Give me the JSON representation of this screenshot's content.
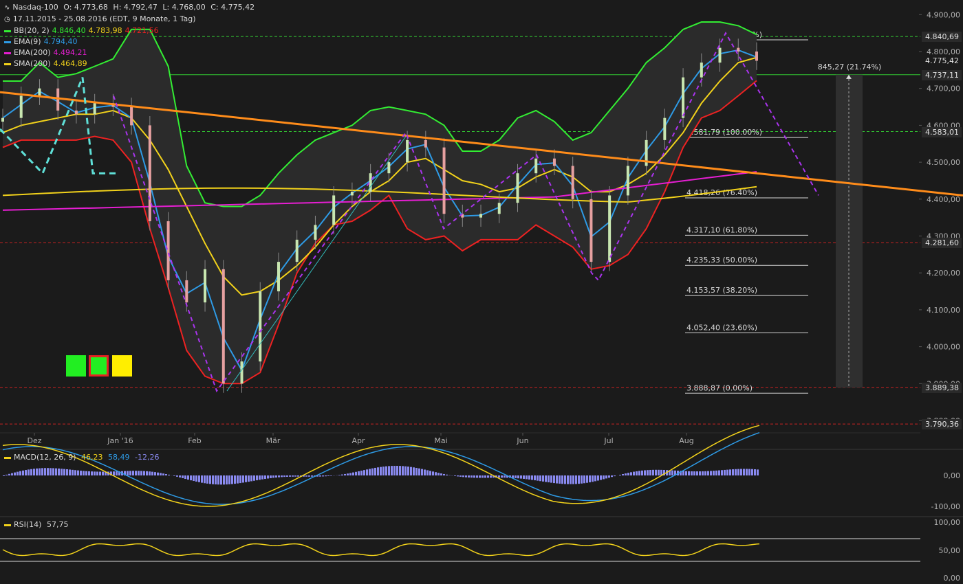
{
  "header": {
    "symbol": "Nasdaq-100",
    "open": "O: 4.773,68",
    "high": "H: 4.792,47",
    "low": "L: 4.768,00",
    "close": "C: 4.775,42",
    "range": "17.11.2015 - 25.08.2016 (EDT, 9 Monate, 1 Tag)",
    "indicators": [
      {
        "label": "BB(20, 2)",
        "color": "#33ee33",
        "values": [
          {
            "text": "4.846,40",
            "color": "#33ee33"
          },
          {
            "text": "4.783,98",
            "color": "#f2d21b"
          },
          {
            "text": "4.721,56",
            "color": "#ee2222"
          }
        ]
      },
      {
        "label": "EMA(9)",
        "color": "#2e9be6",
        "values": [
          {
            "text": "4.794,40",
            "color": "#2e9be6"
          }
        ]
      },
      {
        "label": "EMA(200)",
        "color": "#e61ed2",
        "values": [
          {
            "text": "4.494,21",
            "color": "#e61ed2"
          }
        ]
      },
      {
        "label": "SMA(200)",
        "color": "#f2d21b",
        "values": [
          {
            "text": "4.464,89",
            "color": "#f2d21b"
          }
        ]
      }
    ]
  },
  "price_axis": [
    "4.900,00",
    "4.800,00",
    "4.700,00",
    "4.600,00",
    "4.500,00",
    "4.400,00",
    "4.300,00",
    "4.200,00",
    "4.100,00",
    "4.000,00",
    "3.900,00",
    "3.800,00"
  ],
  "price_labels": [
    {
      "text": "4.840,69",
      "bg": "#2a2a2a",
      "fg": "#e0e0e0"
    },
    {
      "text": "4.775,42",
      "bg": "#1b1b1b",
      "fg": "#e0e0e0"
    },
    {
      "text": "4.737,11",
      "bg": "#2a2a2a",
      "fg": "#e0e0e0"
    },
    {
      "text": "4.583,01",
      "bg": "#2a2a2a",
      "fg": "#e0e0e0"
    },
    {
      "text": "4.281,60",
      "bg": "#2a2a2a",
      "fg": "#e0e0e0"
    },
    {
      "text": "3.889,38",
      "bg": "#2a2a2a",
      "fg": "#e0e0e0"
    },
    {
      "text": "3.790,36",
      "bg": "#2a2a2a",
      "fg": "#e0e0e0"
    }
  ],
  "months": [
    "Dez",
    "Jan '16",
    "Feb",
    "Mär",
    "Apr",
    "Mai",
    "Jun",
    "Jul",
    "Aug"
  ],
  "fib_levels": [
    {
      "price": 4846.49,
      "label": "4.846,49 (138.20%)"
    },
    {
      "price": 4581.79,
      "label": "4.581,79 (100.00%)"
    },
    {
      "price": 4418.26,
      "label": "4.418,26 (76.40%)"
    },
    {
      "price": 4317.1,
      "label": "4.317,10 (61.80%)"
    },
    {
      "price": 4235.33,
      "label": "4.235,33 (50.00%)"
    },
    {
      "price": 4153.57,
      "label": "4.153,57 (38.20%)"
    },
    {
      "price": 4052.4,
      "label": "4.052,40 (23.60%)"
    },
    {
      "price": 3888.87,
      "label": "3.888,87 (0.00%)"
    }
  ],
  "measure_label": "845,27 (21.74%)",
  "macd": {
    "label": "MACD(12, 26, 9)",
    "values": [
      {
        "text": "46,23",
        "color": "#f2d21b"
      },
      {
        "text": "58,49",
        "color": "#2e9be6"
      },
      {
        "text": "-12,26",
        "color": "#8a8af0"
      }
    ],
    "axis": [
      "0,00",
      "-100,00"
    ]
  },
  "rsi": {
    "label": "RSI(14)",
    "value": "57,75",
    "axis": [
      "100,00",
      "50,00",
      "0,00"
    ],
    "bands": [
      "70,00",
      "30,00"
    ]
  },
  "chart_data": {
    "type": "candlestick",
    "title": "Nasdaq-100",
    "ylim": [
      3740,
      4940
    ],
    "hlines": [
      4840.69,
      4737.11,
      4583.01,
      4281.6,
      3889.38,
      3790.36
    ],
    "series": [
      {
        "name": "Nasdaq-100",
        "points": [
          [
            "2015-11-17",
            4620
          ],
          [
            "2015-11-24",
            4680
          ],
          [
            "2015-12-01",
            4700
          ],
          [
            "2015-12-08",
            4640
          ],
          [
            "2015-12-15",
            4630
          ],
          [
            "2015-12-22",
            4660
          ],
          [
            "2015-12-29",
            4650
          ],
          [
            "2016-01-05",
            4600
          ],
          [
            "2016-01-12",
            4340
          ],
          [
            "2016-01-19",
            4180
          ],
          [
            "2016-01-26",
            4120
          ],
          [
            "2016-02-02",
            4210
          ],
          [
            "2016-02-09",
            3900
          ],
          [
            "2016-02-12",
            3960
          ],
          [
            "2016-02-19",
            4150
          ],
          [
            "2016-02-26",
            4230
          ],
          [
            "2016-03-04",
            4290
          ],
          [
            "2016-03-11",
            4330
          ],
          [
            "2016-03-18",
            4410
          ],
          [
            "2016-03-25",
            4420
          ],
          [
            "2016-04-01",
            4470
          ],
          [
            "2016-04-08",
            4500
          ],
          [
            "2016-04-15",
            4560
          ],
          [
            "2016-04-22",
            4540
          ],
          [
            "2016-04-29",
            4360
          ],
          [
            "2016-05-06",
            4350
          ],
          [
            "2016-05-13",
            4360
          ],
          [
            "2016-05-20",
            4390
          ],
          [
            "2016-05-27",
            4470
          ],
          [
            "2016-06-03",
            4510
          ],
          [
            "2016-06-10",
            4490
          ],
          [
            "2016-06-17",
            4400
          ],
          [
            "2016-06-24",
            4230
          ],
          [
            "2016-07-01",
            4410
          ],
          [
            "2016-07-08",
            4490
          ],
          [
            "2016-07-15",
            4560
          ],
          [
            "2016-07-22",
            4620
          ],
          [
            "2016-07-29",
            4730
          ],
          [
            "2016-08-05",
            4770
          ],
          [
            "2016-08-12",
            4810
          ],
          [
            "2016-08-19",
            4800
          ],
          [
            "2016-08-25",
            4775
          ]
        ]
      },
      {
        "name": "BB(20, 2)",
        "values": [
          4846.4,
          4783.98,
          4721.56
        ]
      },
      {
        "name": "EMA(9)",
        "values": [
          4794.4
        ]
      },
      {
        "name": "EMA(200)",
        "values": [
          4494.21
        ]
      },
      {
        "name": "SMA(200)",
        "values": [
          4464.89
        ]
      }
    ]
  }
}
